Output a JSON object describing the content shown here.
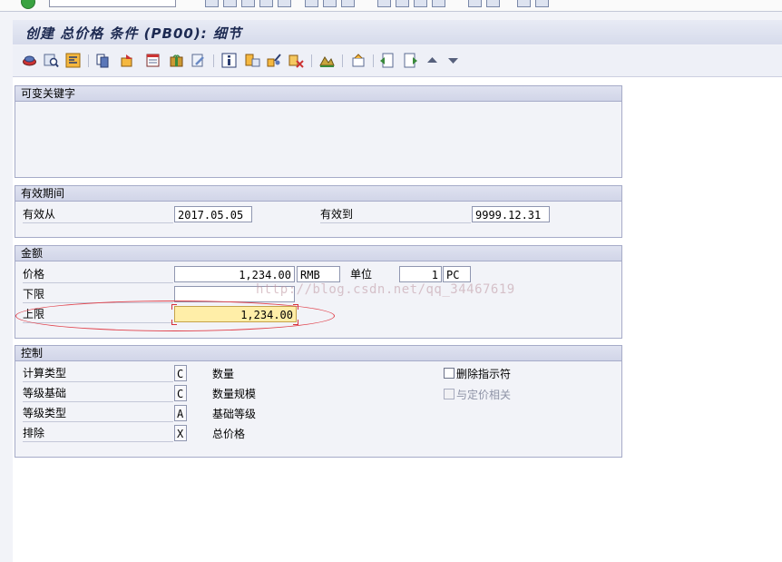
{
  "title": "创建 总价格 条件 (PB00): 细节",
  "groups": {
    "variable_key": {
      "title": "可变关键字"
    },
    "validity": {
      "title": "有效期间",
      "valid_from_label": "有效从",
      "valid_from": "2017.05.05",
      "valid_to_label": "有效到",
      "valid_to": "9999.12.31"
    },
    "amount": {
      "title": "金额",
      "price_label": "价格",
      "price": "1,234.00",
      "currency": "RMB",
      "unit_label": "单位",
      "unit_qty": "1",
      "unit_uom": "PC",
      "lower_label": "下限",
      "lower": "",
      "upper_label": "上限",
      "upper": "1,234.00"
    },
    "control": {
      "title": "控制",
      "rows": [
        {
          "label": "计算类型",
          "code": "C",
          "desc": "数量"
        },
        {
          "label": "等级基础",
          "code": "C",
          "desc": "数量规模"
        },
        {
          "label": "等级类型",
          "code": "A",
          "desc": "基础等级"
        },
        {
          "label": "排除",
          "code": "X",
          "desc": "总价格"
        }
      ],
      "delete_indicator": "删除指示符",
      "pricing_relevant": "与定价相关"
    }
  },
  "watermark": "http://blog.csdn.net/qq_34467619",
  "icons": [
    "back-icon",
    "exit-icon",
    "cancel-icon",
    "print-icon",
    "find-icon",
    "condition-records-icon",
    "scales-icon",
    "additional-data-icon",
    "details-icon",
    "texts-icon",
    "info-icon",
    "vakey-icon",
    "copy-icon",
    "delete-icon",
    "overview-icon",
    "prev-page-icon",
    "next-page-icon",
    "arrow-up-icon",
    "arrow-down-icon"
  ]
}
